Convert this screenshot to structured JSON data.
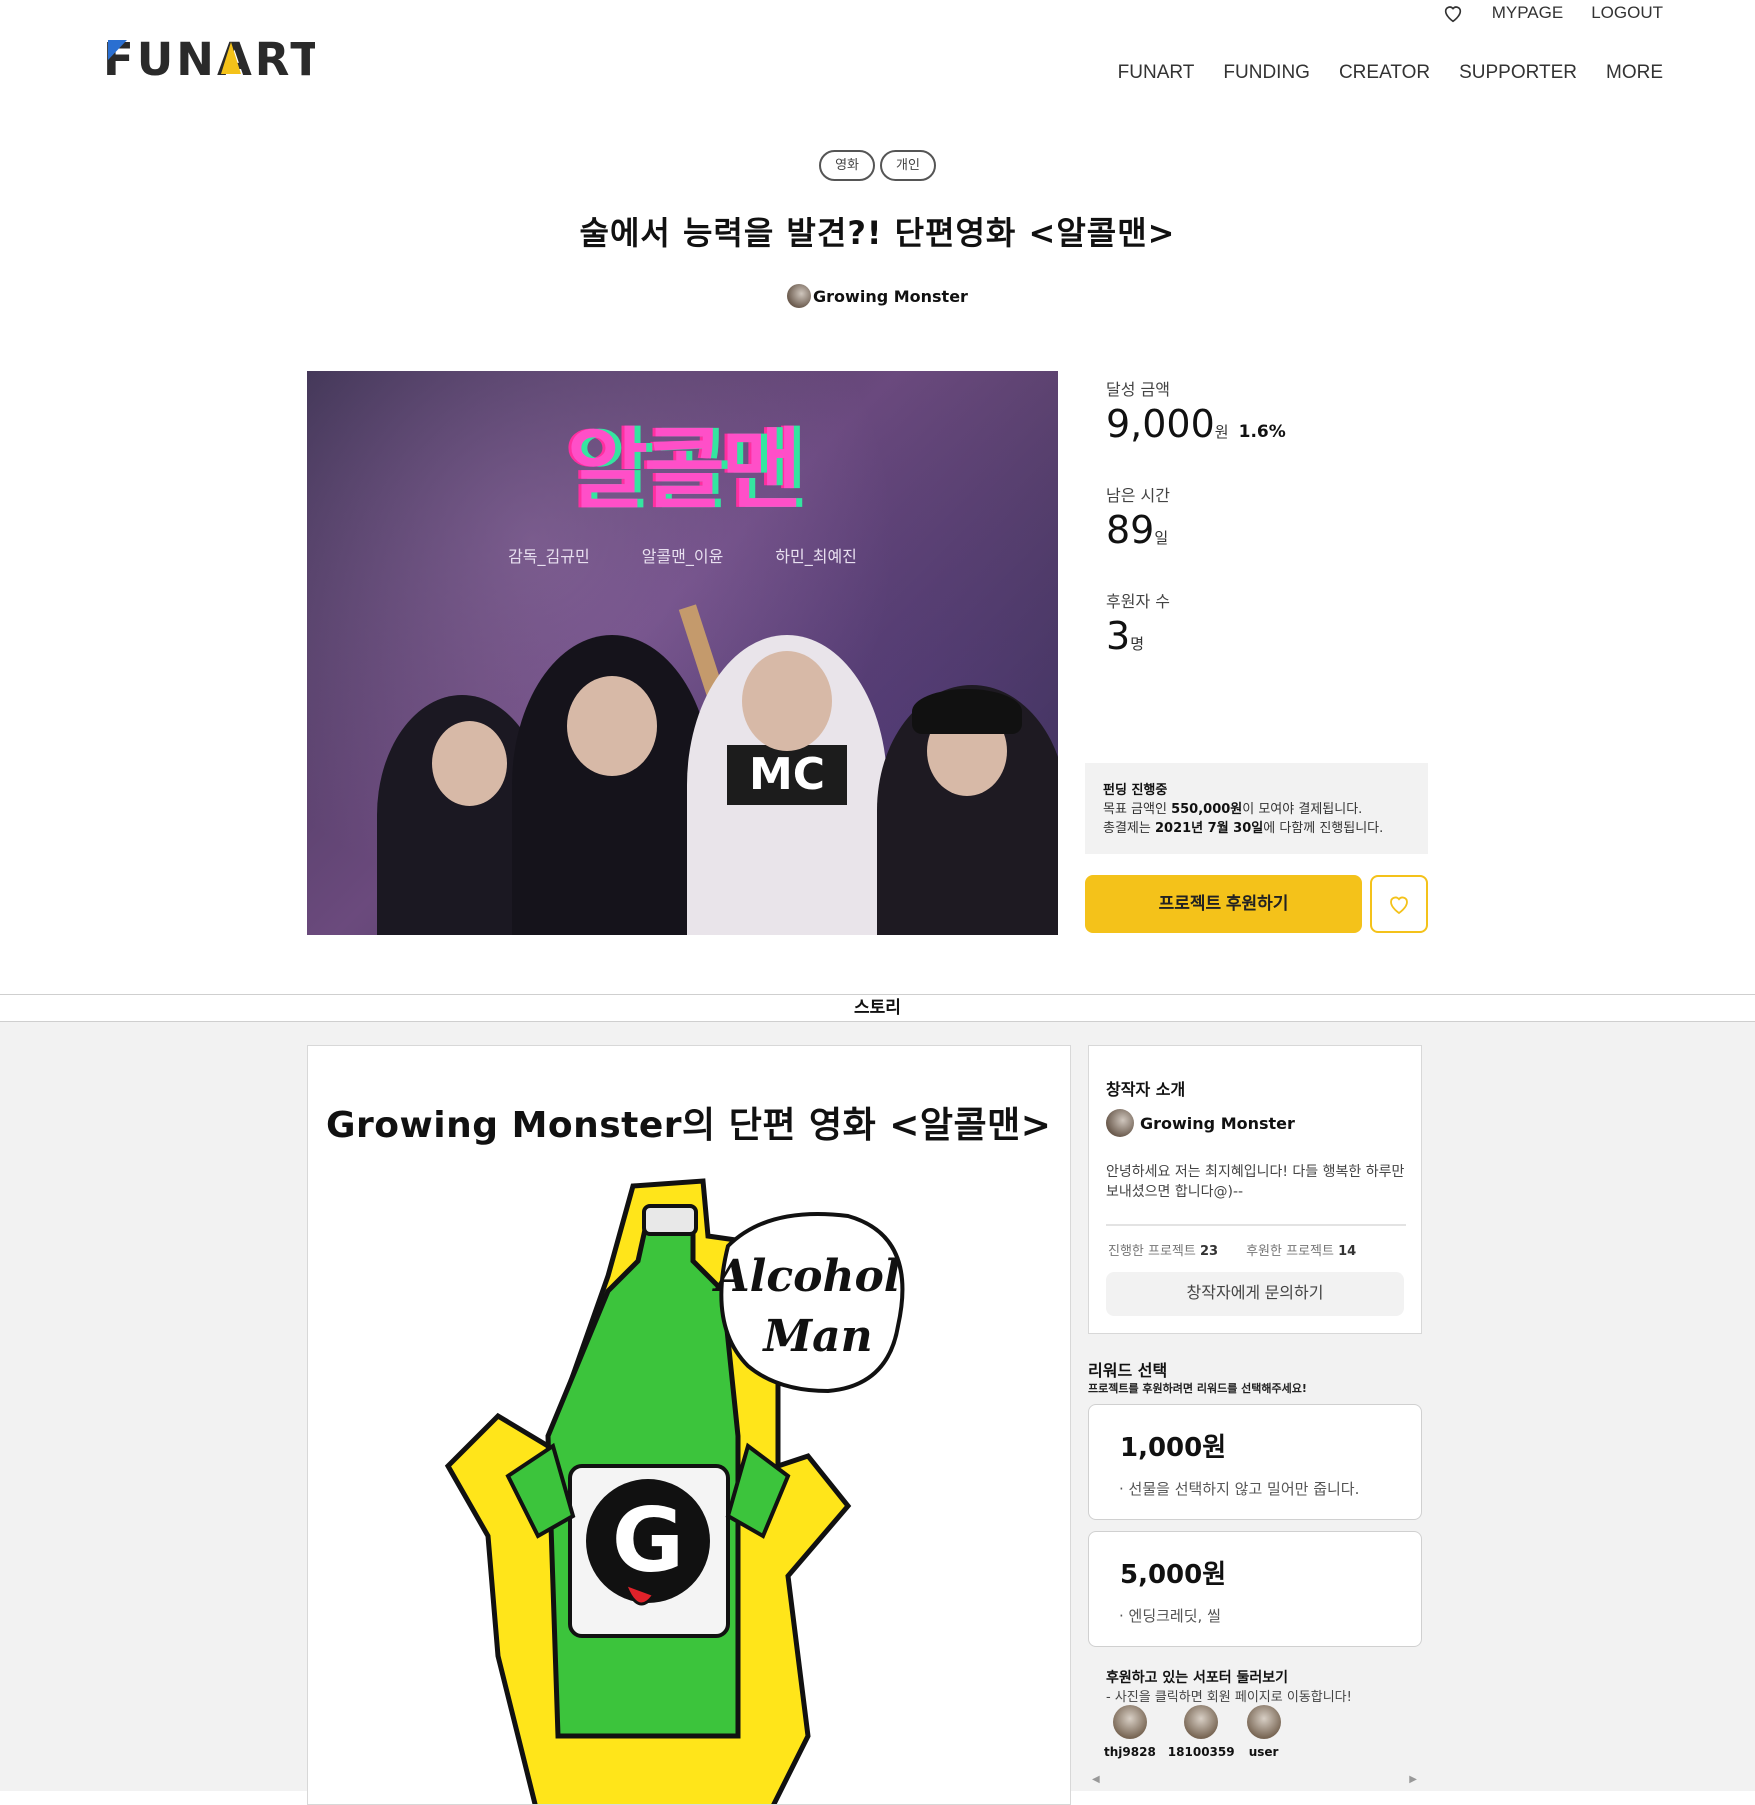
{
  "header": {
    "logo": "FUNART",
    "util": {
      "heart_icon": "heart-outline-icon",
      "mypage": "MYPAGE",
      "logout": "LOGOUT"
    },
    "nav": [
      "FUNART",
      "FUNDING",
      "CREATOR",
      "SUPPORTER",
      "MORE"
    ]
  },
  "project": {
    "tags": [
      "영화",
      "개인"
    ],
    "title": "술에서 능력을 발견?! 단편영화 <알콜맨>",
    "creator": "Growing Monster",
    "poster": {
      "title": "알콜맨",
      "credits": [
        "감독_김규민",
        "알콜맨_이윤",
        "하민_최예진"
      ],
      "badge": "MC"
    }
  },
  "stats": {
    "amount_label": "달성 금액",
    "amount": "9,000",
    "amount_unit": "원",
    "percent": "1.6%",
    "time_label": "남은 시간",
    "days": "89",
    "days_unit": "일",
    "supporters_label": "후원자 수",
    "supporters": "3",
    "supporters_unit": "명"
  },
  "funding_box": {
    "status": "펀딩 진행중",
    "line1_pre": "목표 금액인 ",
    "goal": "550,000원",
    "line1_post": "이 모여야 결제됩니다.",
    "line2_pre": "총결제는 ",
    "date": "2021년 7월 30일",
    "line2_post": "에 다함께 진행됩니다."
  },
  "buttons": {
    "support": "프로젝트 후원하기",
    "like_icon": "heart-outline-icon"
  },
  "tab": {
    "story": "스토리"
  },
  "story": {
    "title": "Growing Monster의 단편 영화 <알콜맨>",
    "bubble_line1": "Alcohol",
    "bubble_line2": "Man",
    "bottle_letter": "G"
  },
  "creator_card": {
    "heading": "창작자 소개",
    "name": "Growing Monster",
    "intro": "안녕하세요 저는 최지혜입니다! 다들 행복한 하루만 보내셨으면 합니다@)--",
    "projects_label": "진행한 프로젝트",
    "projects": "23",
    "backed_label": "후원한 프로젝트",
    "backed": "14",
    "ask": "창작자에게 문의하기"
  },
  "rewards": {
    "heading": "리워드 선택",
    "sub": "프로젝트를 후원하려면 리워드를 선택해주세요!",
    "items": [
      {
        "price": "1,000원",
        "desc": "· 선물을 선택하지 않고 밀어만 줍니다."
      },
      {
        "price": "5,000원",
        "desc": "· 엔딩크레딧, 씰"
      }
    ]
  },
  "supporters": {
    "heading": "후원하고 있는 서포터 둘러보기",
    "sub": "- 사진을 클릭하면 회원 페이지로 이동합니다!",
    "list": [
      "thj9828",
      "18100359",
      "user"
    ]
  },
  "colors": {
    "accent": "#f4c21a",
    "panel_bg": "#f2f2f2"
  }
}
